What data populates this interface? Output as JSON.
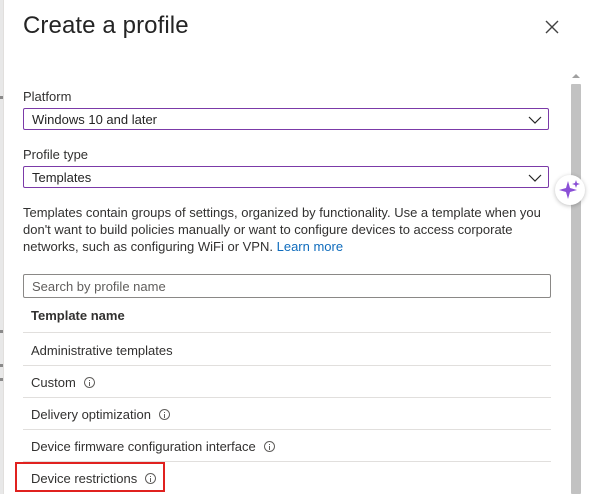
{
  "dialog": {
    "title": "Create a profile",
    "close_icon": "close-icon"
  },
  "platform": {
    "label": "Platform",
    "value": "Windows 10 and later"
  },
  "profile_type": {
    "label": "Profile type",
    "value": "Templates"
  },
  "description": {
    "text": "Templates contain groups of settings, organized by functionality. Use a template when you don't want to build policies manually or want to configure devices to access corporate networks, such as configuring WiFi or VPN.",
    "link": "Learn more"
  },
  "search": {
    "placeholder": "Search by profile name"
  },
  "table": {
    "header": "Template name",
    "rows": [
      {
        "name": "Administrative templates"
      },
      {
        "name": "Custom"
      },
      {
        "name": "Delivery optimization"
      },
      {
        "name": "Device firmware configuration interface"
      },
      {
        "name": "Device restrictions"
      }
    ]
  },
  "colors": {
    "accent_border": "#7b3aa8",
    "link": "#0f6cbd",
    "highlight": "#e0211f",
    "sparkle": "#8a4fd6"
  }
}
